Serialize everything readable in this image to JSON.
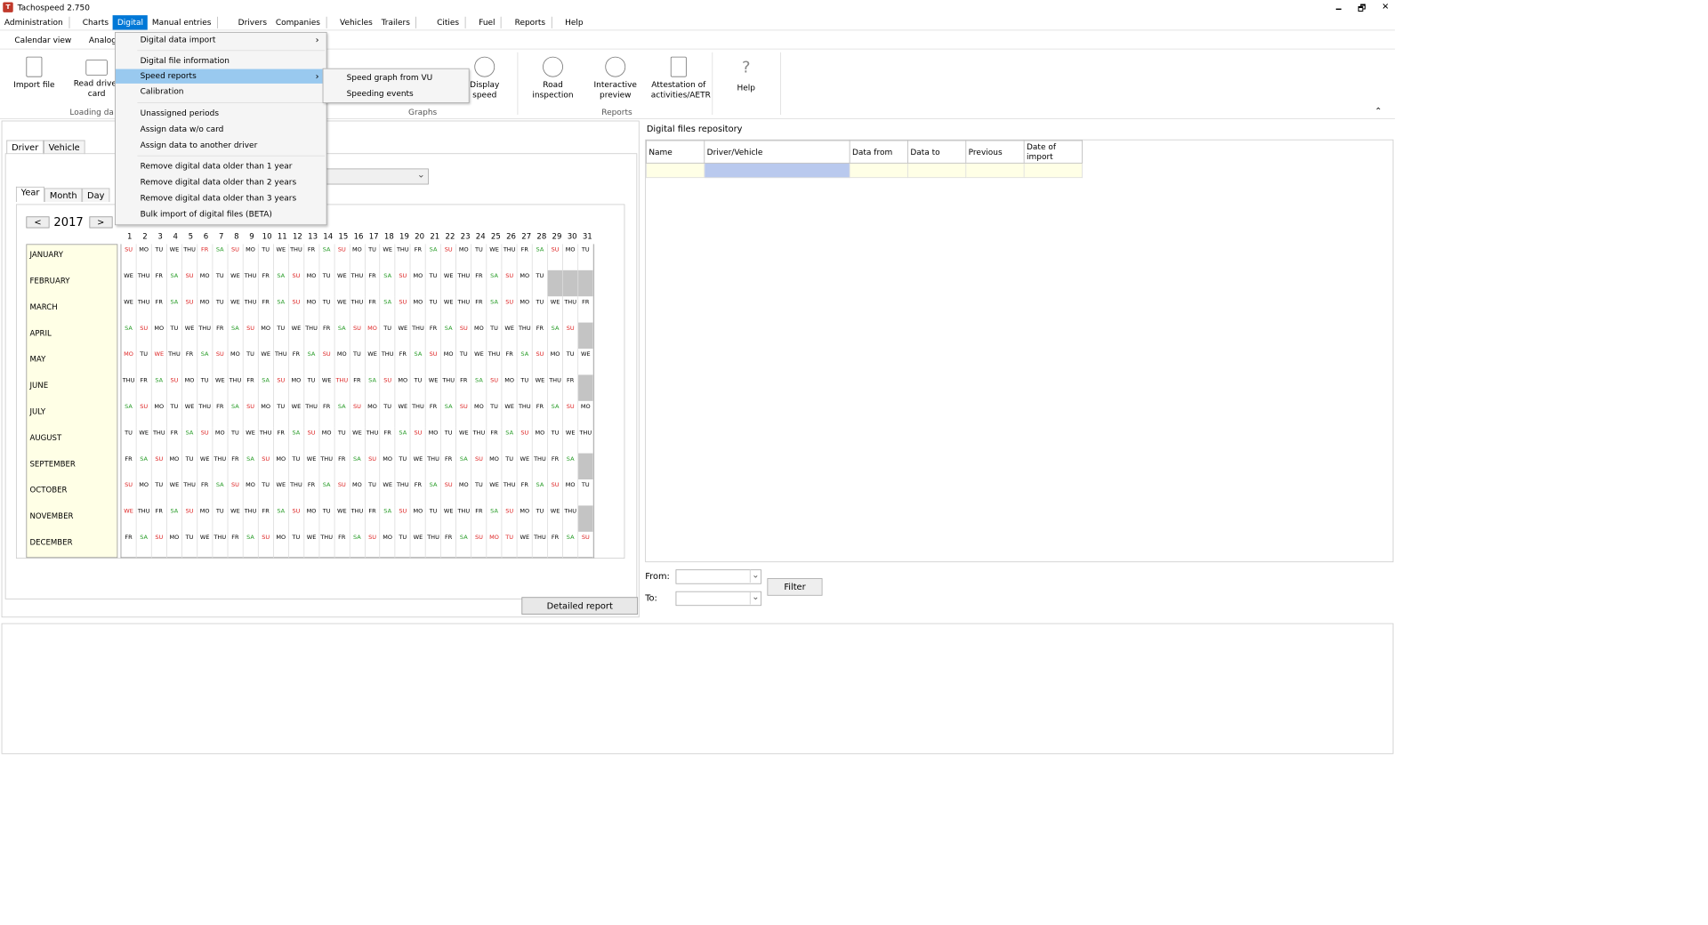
{
  "window": {
    "title": "Tachospeed 2.750",
    "minimize": "🗕",
    "restore": "🗗",
    "close": "✕"
  },
  "menubar": [
    "Administration",
    "Charts",
    "Digital",
    "Manual entries",
    "Drivers",
    "Companies",
    "Vehicles",
    "Trailers",
    "Cities",
    "Fuel",
    "Reports",
    "Help"
  ],
  "subtabs": [
    "Calendar view",
    "Analog"
  ],
  "ribbon": {
    "import_file": "Import file",
    "read_driver_card": "Read driver card",
    "display_speed": "Display speed",
    "road_inspection": "Road inspection",
    "interactive_preview": "Interactive preview",
    "attestation": "Attestation of activities/AETR",
    "help": "Help",
    "group_loading": "Loading da",
    "group_graphs": "Graphs",
    "group_reports": "Reports",
    "collapse": "⌃"
  },
  "left": {
    "tabs": [
      "Driver",
      "Vehicle"
    ],
    "period_tabs": [
      "Year",
      "Month",
      "Day"
    ],
    "prev": "<",
    "next": ">",
    "year": "2017",
    "detailed_report": "Detailed report"
  },
  "calendar": {
    "months": [
      "JANUARY",
      "FEBRUARY",
      "MARCH",
      "APRIL",
      "MAY",
      "JUNE",
      "JULY",
      "AUGUST",
      "SEPTEMBER",
      "OCTOBER",
      "NOVEMBER",
      "DECEMBER"
    ],
    "month_start_weekday": [
      6,
      2,
      2,
      5,
      0,
      3,
      5,
      1,
      4,
      6,
      2,
      4
    ],
    "month_days": [
      31,
      28,
      31,
      30,
      31,
      30,
      31,
      31,
      30,
      31,
      30,
      31
    ],
    "weekday_labels": [
      "MO",
      "TU",
      "WE",
      "THU",
      "FR",
      "SA",
      "SU"
    ],
    "holidays": {
      "0": [
        6
      ],
      "3": [
        17
      ],
      "4": [
        1,
        3
      ],
      "5": [
        15
      ],
      "10": [
        1
      ],
      "11": [
        25,
        26
      ]
    }
  },
  "right": {
    "title": "Digital files repository",
    "columns": [
      "Name",
      "Driver/Vehicle",
      "Data from",
      "Data to",
      "Previous",
      "Date of import"
    ],
    "from_label": "From:",
    "to_label": "To:",
    "filter": "Filter"
  },
  "digital_menu": {
    "items": [
      {
        "label": "Digital data import",
        "arrow": "›"
      },
      {
        "label": "Digital file information"
      },
      {
        "label": "Speed reports",
        "arrow": "›"
      },
      {
        "label": "Calibration"
      },
      {
        "label": "Unassigned periods"
      },
      {
        "label": "Assign data w/o card"
      },
      {
        "label": "Assign data to another driver"
      },
      {
        "label": "Remove digital data older than 1 year"
      },
      {
        "label": "Remove digital data older than 2 years"
      },
      {
        "label": "Remove digital data older than 3 years"
      },
      {
        "label": "Bulk import of digital files (BETA)"
      }
    ],
    "highlighted": "Speed reports"
  },
  "speed_submenu": [
    "Speed graph from VU",
    "Speeding events"
  ],
  "colors": {
    "menu_active": "#0078d7",
    "menu_highlight": "#99c9ef",
    "saturday": "#2a9d2a",
    "sunday": "#dd2222",
    "month_bg": "#ffffe6"
  }
}
